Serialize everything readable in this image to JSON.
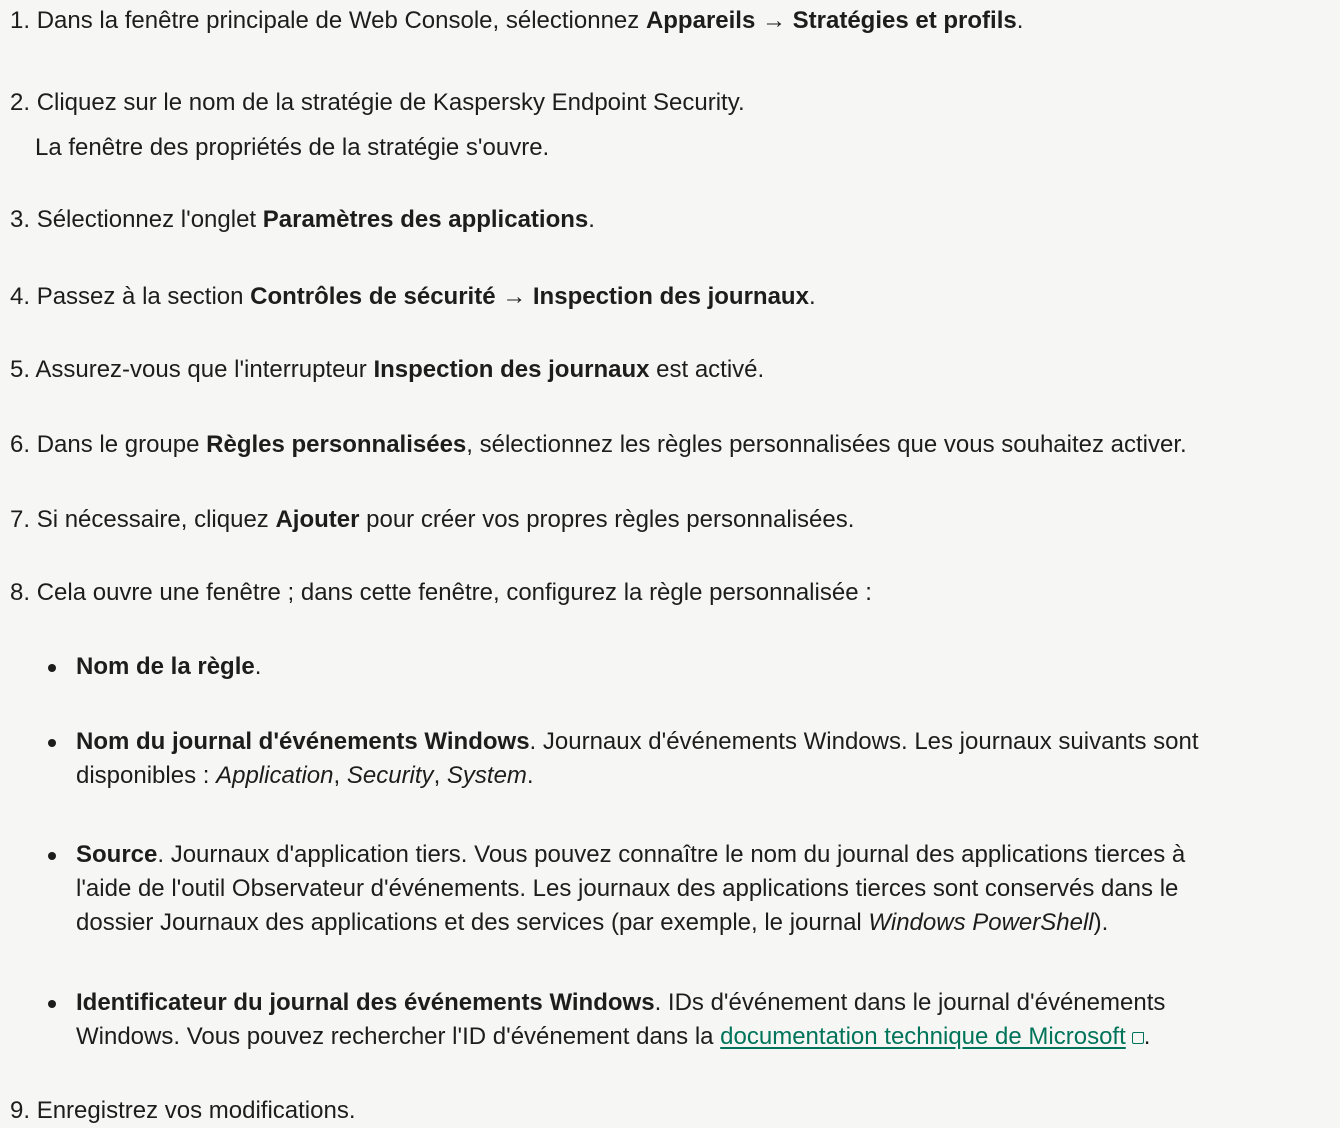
{
  "steps": [
    {
      "num": "1.",
      "pre": "Dans la fenêtre principale de Web Console, sélectionnez ",
      "bold": "Appareils → Stratégies et profils",
      "post": "."
    },
    {
      "num": "2.",
      "text": "Cliquez sur le nom de la stratégie de Kaspersky Endpoint Security.",
      "sub": "La fenêtre des propriétés de la stratégie s'ouvre."
    },
    {
      "num": "3.",
      "pre": "Sélectionnez l'onglet ",
      "bold": "Paramètres des applications",
      "post": "."
    },
    {
      "num": "4.",
      "pre": "Passez à la section ",
      "bold1": "Contrôles de sécurité",
      "arrow": " → ",
      "bold2": "Inspection des journaux",
      "post": "."
    },
    {
      "num": "5.",
      "pre": "Assurez-vous que l'interrupteur ",
      "bold": "Inspection des journaux",
      "post": " est activé."
    },
    {
      "num": "6.",
      "pre": "Dans le groupe ",
      "bold": "Règles personnalisées",
      "post": ", sélectionnez les règles personnalisées que vous souhaitez activer."
    },
    {
      "num": "7.",
      "pre": "Si nécessaire, cliquez ",
      "bold": "Ajouter",
      "post": " pour créer vos propres règles personnalisées."
    },
    {
      "num": "8.",
      "text": "Cela ouvre une fenêtre ; dans cette fenêtre, configurez la règle personnalisée :"
    },
    {
      "num": "9.",
      "text": "Enregistrez vos modifications."
    }
  ],
  "bullets": [
    {
      "bold": "Nom de la règle",
      "post": "."
    },
    {
      "bold": "Nom du journal d'événements Windows",
      "line1": ". Journaux d'événements Windows. Les journaux suivants sont",
      "line2_pre": "disponibles : ",
      "it1": "Application",
      "sep1": ", ",
      "it2": "Security",
      "sep2": ", ",
      "it3": "System",
      "end": "."
    },
    {
      "bold": "Source",
      "line1": ". Journaux d'application tiers. Vous pouvez connaître le nom du journal des applications tierces à",
      "line2": "l'aide de l'outil Observateur d'événements. Les journaux des applications tierces sont conservés dans le",
      "line3_pre": "dossier Journaux des applications et des services (par exemple, le journal ",
      "it": "Windows PowerShell",
      "line3_post": ")."
    },
    {
      "bold": "Identificateur du journal des événements Windows",
      "line1": ". IDs d'événement dans le journal d'événements",
      "line2_pre": "Windows. Vous pouvez rechercher l'ID d'événement dans la ",
      "link": "documentation technique de Microsoft",
      "line2_post": "."
    }
  ],
  "colors": {
    "background": "#f6f6f4",
    "text": "#1d1d1b",
    "link": "#00745a"
  },
  "icons": {
    "external_link": "external-link-icon",
    "bullet": "bullet-dot"
  }
}
